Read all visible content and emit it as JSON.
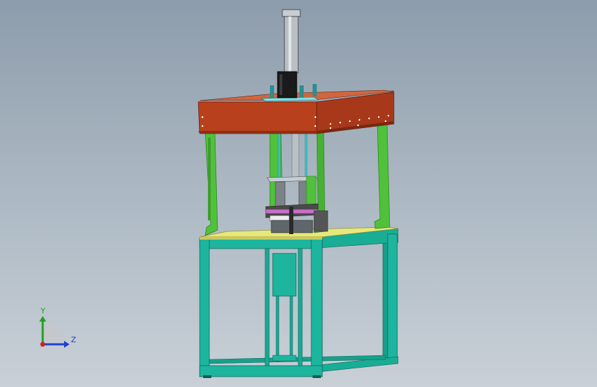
{
  "viewport": {
    "background_top": "#8d9cac",
    "background_bottom": "#c9d0d7"
  },
  "model": {
    "colors": {
      "upper_frame": "#b8401c",
      "upper_frame_dark": "#8e2e12",
      "columns": "#4fc13a",
      "columns_dark": "#2f8a22",
      "base_frame": "#1db59e",
      "base_frame_dark": "#10806e",
      "table_top": "#e8e87a",
      "cylinder": "#a9b0b6",
      "motor": "#1a1a1a",
      "fixture": "#5a5a5a"
    }
  },
  "triad": {
    "y_label": "Y",
    "z_label": "Z",
    "y_color": "#1fa01f",
    "z_color": "#1f3fd0",
    "origin_color": "#d02020"
  }
}
